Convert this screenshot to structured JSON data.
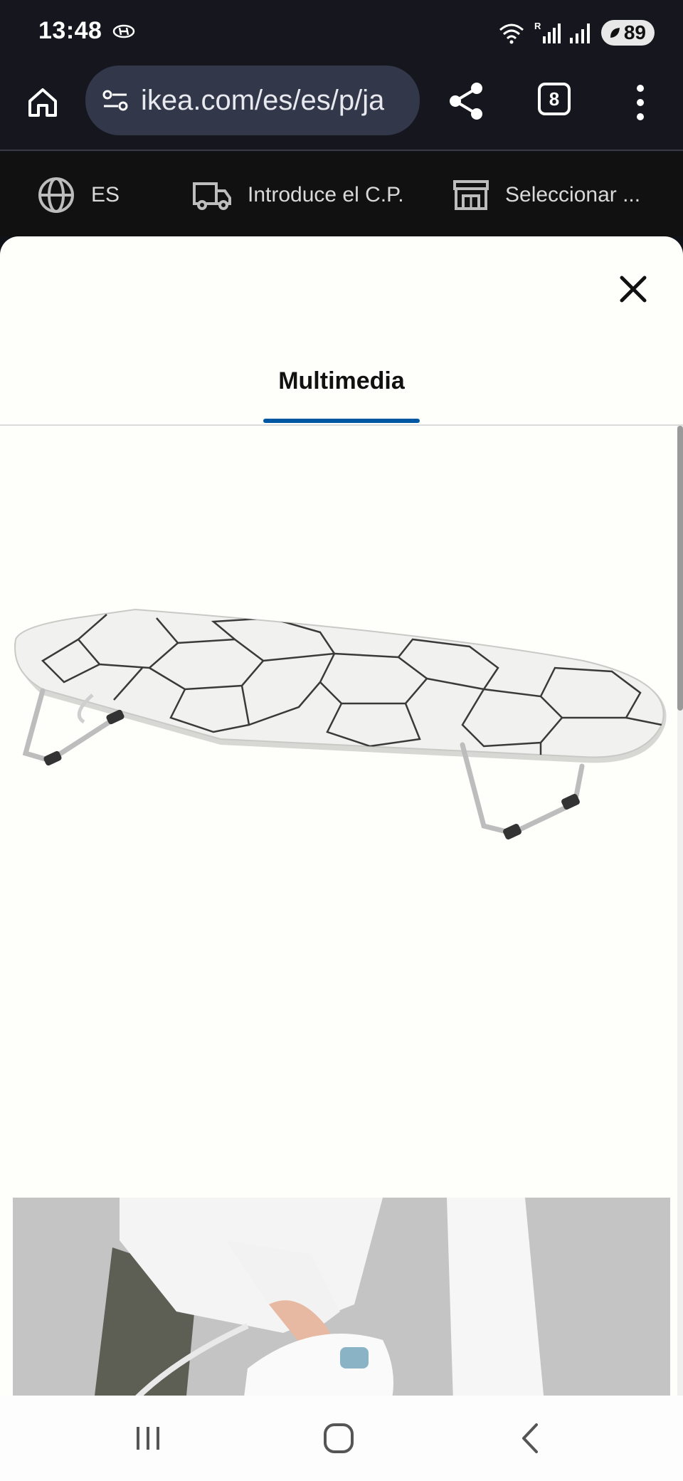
{
  "status_bar": {
    "time": "13:48",
    "battery": "89",
    "icons": [
      "hyundai-logo-icon",
      "wifi-icon",
      "signal-r-icon",
      "signal-icon",
      "battery-icon"
    ]
  },
  "browser": {
    "url": "ikea.com/es/es/p/ja",
    "tab_count": "8",
    "icons": [
      "home-icon",
      "site-settings-icon",
      "share-icon",
      "menu-dots-icon"
    ]
  },
  "ikea_bar": {
    "language": "ES",
    "postal_code": "Introduce el C.P.",
    "store": "Seleccionar ..."
  },
  "modal": {
    "tab_label": "Multimedia",
    "accent_color": "#0058a3",
    "images": [
      {
        "name": "ironing-board-product-image"
      },
      {
        "name": "person-ironing-image"
      }
    ]
  }
}
